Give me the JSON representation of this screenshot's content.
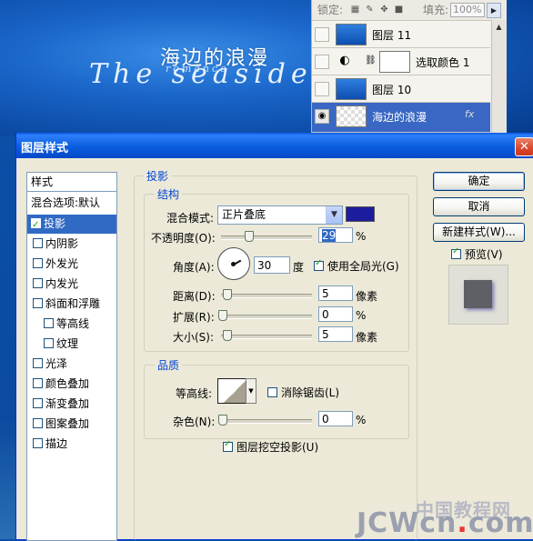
{
  "background": {
    "title_cn": "海边的浪漫",
    "title_script": "The seaside",
    "subtitle_script": "romance"
  },
  "layers_panel": {
    "lock_label": "锁定:",
    "fill_label": "填充:",
    "fill_value": "100%",
    "layers": [
      {
        "name": "图层 11",
        "selected": false
      },
      {
        "name": "选取颜色 1",
        "selected": false
      },
      {
        "name": "图层 10",
        "selected": false
      },
      {
        "name": "海边的浪漫",
        "selected": true,
        "fx": "fx"
      }
    ]
  },
  "dialog": {
    "title": "图层样式",
    "styles_header": "样式",
    "blending_options": "混合选项:默认",
    "styles": [
      {
        "label": "投影",
        "checked": true,
        "selected": true
      },
      {
        "label": "内阴影",
        "checked": false
      },
      {
        "label": "外发光",
        "checked": false
      },
      {
        "label": "内发光",
        "checked": false
      },
      {
        "label": "斜面和浮雕",
        "checked": false
      },
      {
        "label": "等高线",
        "checked": false,
        "indent": true
      },
      {
        "label": "纹理",
        "checked": false,
        "indent": true
      },
      {
        "label": "光泽",
        "checked": false
      },
      {
        "label": "颜色叠加",
        "checked": false
      },
      {
        "label": "渐变叠加",
        "checked": false
      },
      {
        "label": "图案叠加",
        "checked": false
      },
      {
        "label": "描边",
        "checked": false
      }
    ],
    "drop_shadow": {
      "section_title": "投影",
      "structure_title": "结构",
      "blend_mode_label": "混合模式:",
      "blend_mode_value": "正片叠底",
      "shadow_color": "#1c1c9e",
      "opacity_label": "不透明度(O):",
      "opacity_value": "29",
      "opacity_unit": "%",
      "angle_label": "角度(A):",
      "angle_value": "30",
      "angle_unit": "度",
      "global_light_label": "使用全局光(G)",
      "global_light_checked": true,
      "distance_label": "距离(D):",
      "distance_value": "5",
      "distance_unit": "像素",
      "spread_label": "扩展(R):",
      "spread_value": "0",
      "spread_unit": "%",
      "size_label": "大小(S):",
      "size_value": "5",
      "size_unit": "像素",
      "quality_title": "品质",
      "contour_label": "等高线:",
      "antialias_label": "消除锯齿(L)",
      "antialias_checked": false,
      "noise_label": "杂色(N):",
      "noise_value": "0",
      "noise_unit": "%",
      "knockout_label": "图层挖空投影(U)",
      "knockout_checked": true
    },
    "buttons": {
      "ok": "确定",
      "cancel": "取消",
      "new_style": "新建样式(W)...",
      "preview_label": "预览(V)",
      "preview_checked": true
    }
  },
  "watermark": {
    "line1": "中国教程网",
    "line2_a": "JCWcn",
    "line2_dot": ".",
    "line2_b": "com"
  }
}
